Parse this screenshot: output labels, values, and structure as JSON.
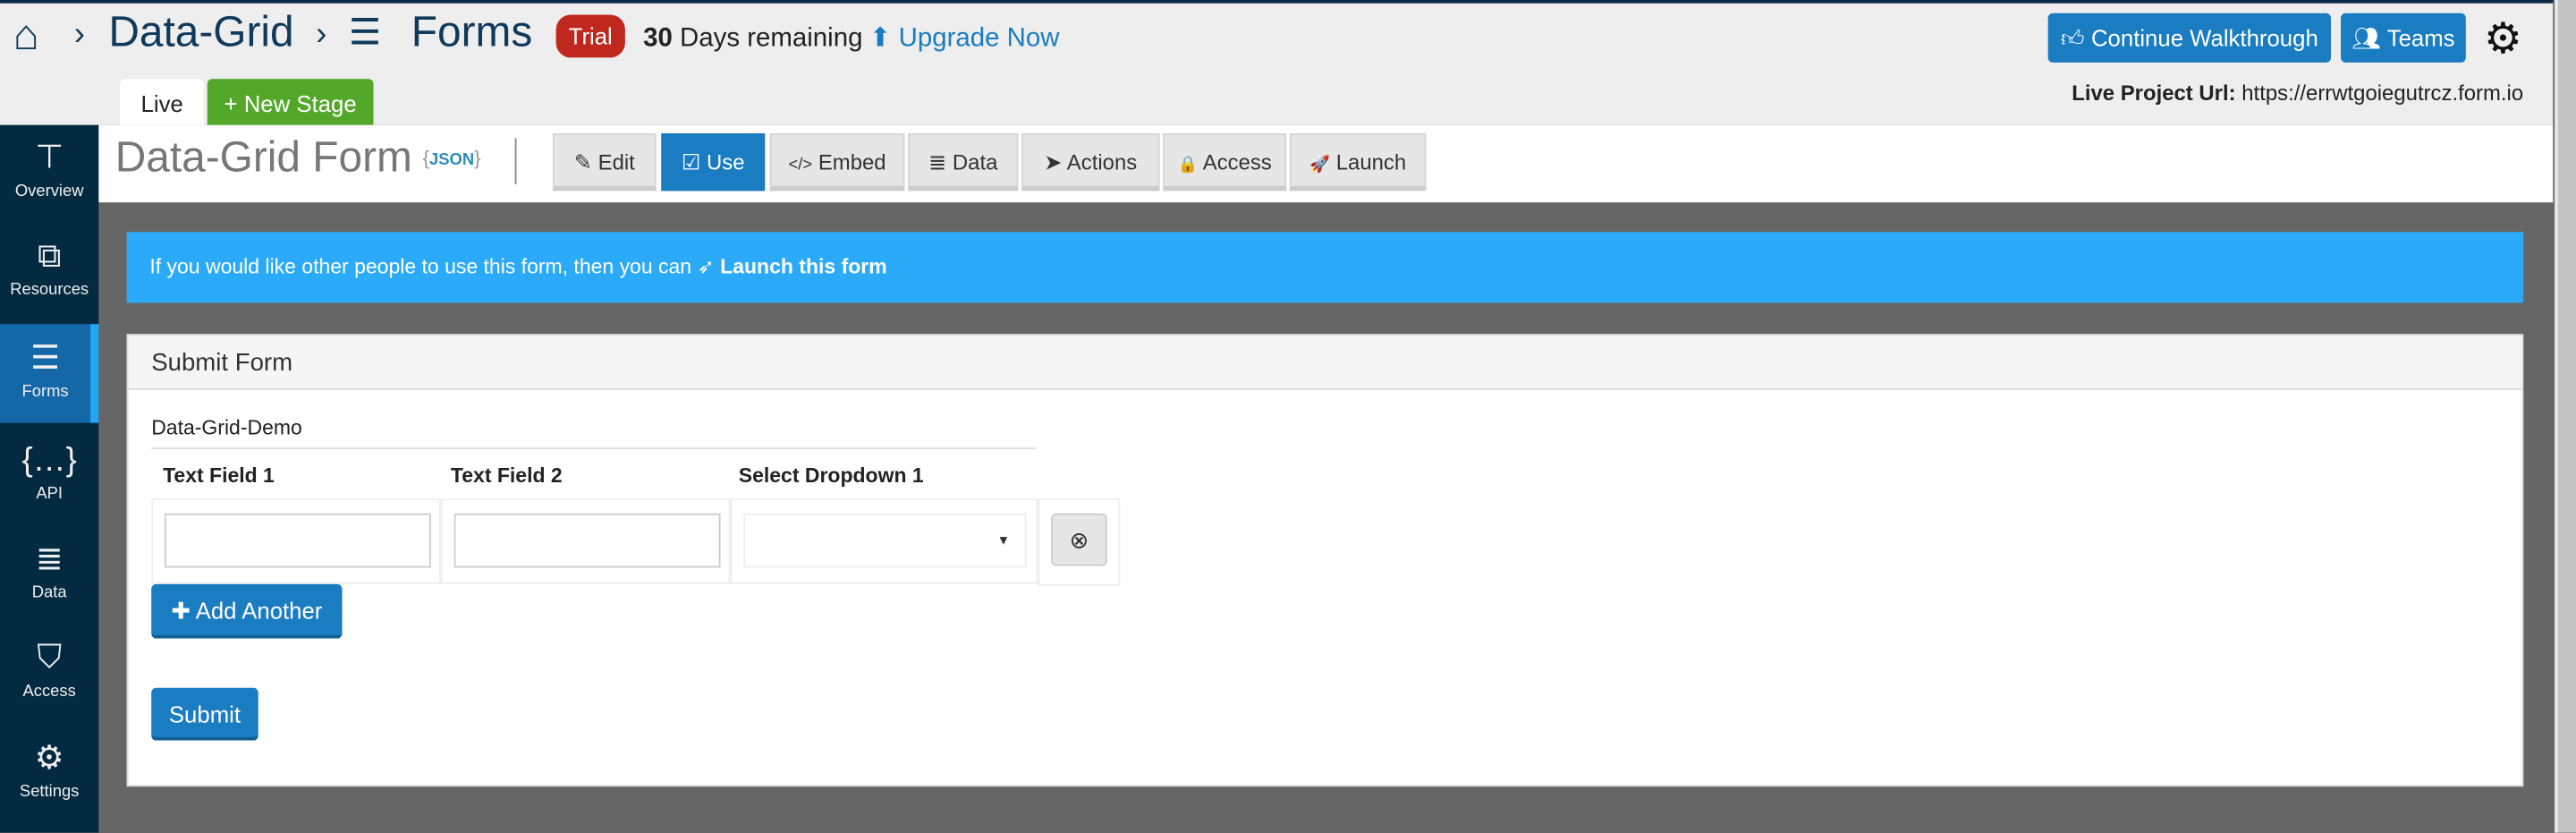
{
  "breadcrumb": {
    "project": "Data-Grid",
    "section": "Forms",
    "separator": "›"
  },
  "trial": {
    "badge": "Trial",
    "days": "30",
    "days_text": "Days remaining",
    "upgrade": "Upgrade Now"
  },
  "stages": {
    "live": "Live",
    "new_stage": "+ New Stage"
  },
  "header_actions": {
    "walkthrough": "Continue Walkthrough",
    "teams": "Teams"
  },
  "live_url": {
    "label": "Live Project Url:",
    "value": "https://errwtgoiegutrcz.form.io"
  },
  "sidebar": {
    "items": [
      {
        "label": "Overview",
        "icon": "sitemap-icon"
      },
      {
        "label": "Resources",
        "icon": "resources-icon"
      },
      {
        "label": "Forms",
        "icon": "forms-icon",
        "active": true
      },
      {
        "label": "API",
        "icon": "api-icon"
      },
      {
        "label": "Data",
        "icon": "database-icon"
      },
      {
        "label": "Access",
        "icon": "shield-icon"
      },
      {
        "label": "Settings",
        "icon": "gear-icon"
      }
    ]
  },
  "form": {
    "title": "Data-Grid Form",
    "json": "JSON"
  },
  "nav": {
    "items": [
      {
        "label": "Edit",
        "icon": "✎"
      },
      {
        "label": "Use",
        "icon": "☑",
        "active": true
      },
      {
        "label": "Embed",
        "icon": "</>"
      },
      {
        "label": "Data",
        "icon": "≣"
      },
      {
        "label": "Actions",
        "icon": "➤"
      },
      {
        "label": "Access",
        "icon": "🔒"
      },
      {
        "label": "Launch",
        "icon": "🚀"
      }
    ]
  },
  "alert": {
    "text": "If you would like other people to use this form, then you can",
    "link": "Launch this form"
  },
  "panel": {
    "heading": "Submit Form",
    "grid_label": "Data-Grid-Demo",
    "columns": [
      "Text Field 1",
      "Text Field 2",
      "Select Dropdown 1"
    ],
    "row": {
      "text1": "",
      "text2": "",
      "select": ""
    },
    "add_label": "Add Another",
    "submit_label": "Submit"
  },
  "colors": {
    "brand": "#1a7cc1",
    "sidebar": "#032a40",
    "alert": "#2aaaf8",
    "trial": "#c0281d",
    "new_stage": "#53a82a"
  }
}
